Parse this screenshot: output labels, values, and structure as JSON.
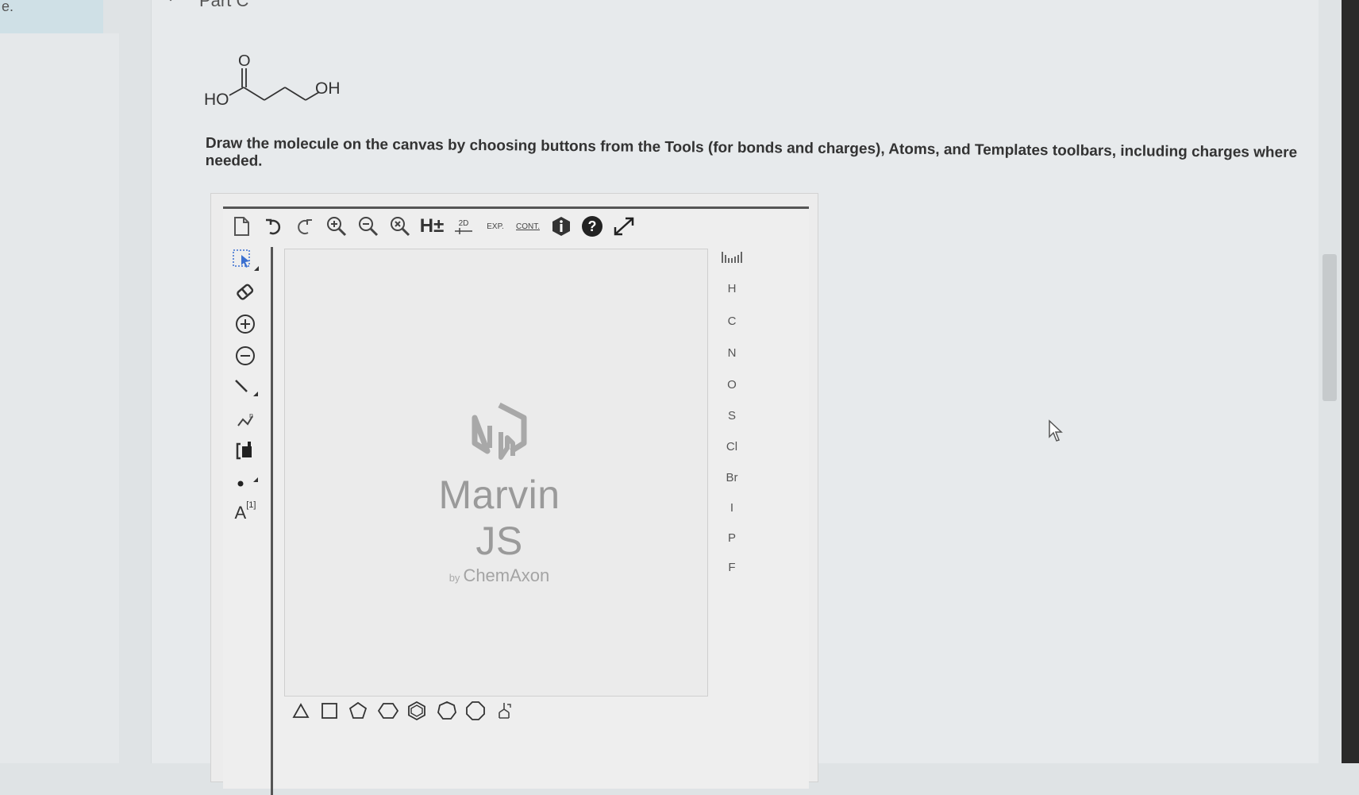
{
  "left_strip": {
    "text": "e."
  },
  "part": {
    "title": "Part C"
  },
  "molecule": {
    "left_label": "HO",
    "right_label": "OH",
    "carbonyl_label": "O"
  },
  "instructions": {
    "text": "Draw the molecule on the canvas by choosing buttons from the Tools (for bonds and charges), Atoms, and Templates toolbars, including charges where needed."
  },
  "top_toolbar": {
    "h_label": "H±",
    "clean2d_label": "2D",
    "expand_label": "EXP.",
    "contract_label": "CONT."
  },
  "left_toolbar": {
    "atom_map_label": "A",
    "atom_map_sup": "[1]"
  },
  "canvas": {
    "brand_name": "Marvin JS",
    "brand_by": "by",
    "brand_company": "ChemAxon"
  },
  "atoms": [
    "H",
    "C",
    "N",
    "O",
    "S",
    "Cl",
    "Br",
    "I",
    "P",
    "F"
  ],
  "icons": {
    "new": "new-document-icon",
    "undo": "undo-icon",
    "redo": "redo-icon",
    "zoom_in": "zoom-in-icon",
    "zoom_out": "zoom-out-icon",
    "zoom_reset": "zoom-reset-icon",
    "info": "info-icon",
    "help": "help-icon",
    "fullscreen": "fullscreen-icon"
  },
  "templates": [
    "triangle",
    "square",
    "pentagon",
    "hexagon",
    "benzene",
    "heptagon",
    "octagon",
    "template-library"
  ]
}
